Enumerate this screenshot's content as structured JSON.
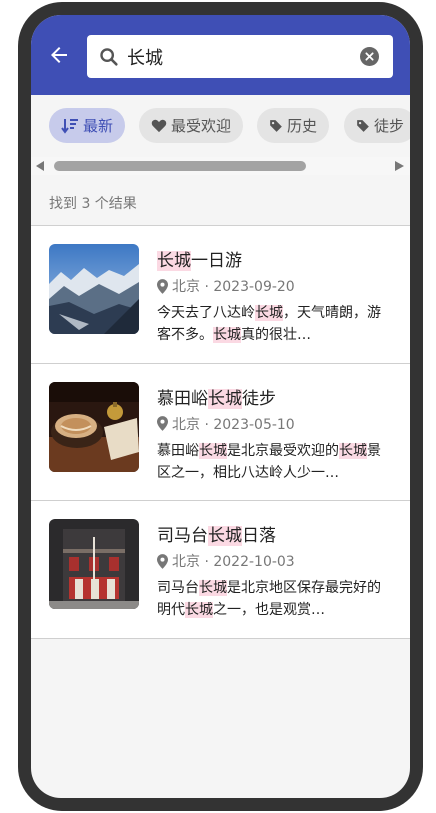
{
  "search": {
    "value": "长城"
  },
  "filters": [
    {
      "label": "最新",
      "icon": "sort-icon",
      "active": true
    },
    {
      "label": "最受欢迎",
      "icon": "heart-icon",
      "active": false
    },
    {
      "label": "历史",
      "icon": "tag-icon",
      "active": false
    },
    {
      "label": "徒步",
      "icon": "tag-icon",
      "active": false
    }
  ],
  "results": {
    "count_text": "找到 3 个结果",
    "highlight": "长城",
    "items": [
      {
        "title": "长城一日游",
        "location": "北京",
        "date": "2023-09-20",
        "meta": "北京 · 2023-09-20",
        "desc": "今天去了八达岭长城，天气晴朗，游客不多。长城真的很壮…",
        "image": "mountain-snow-photo"
      },
      {
        "title": "慕田峪长城徒步",
        "location": "北京",
        "date": "2023-05-10",
        "meta": "北京 · 2023-05-10",
        "desc": "慕田峪长城是北京最受欢迎的长城景区之一，相比八达岭人少一…",
        "image": "coffee-cup-photo"
      },
      {
        "title": "司马台长城日落",
        "location": "北京",
        "date": "2022-10-03",
        "meta": "北京 · 2022-10-03",
        "desc": "司马台长城是北京地区保存最完好的明代长城之一，也是观赏…",
        "image": "building-facade-photo"
      }
    ]
  },
  "colors": {
    "header": "#3f4fb5",
    "chip_active": "#c7cbeb",
    "highlight": "#fbd9e3"
  }
}
